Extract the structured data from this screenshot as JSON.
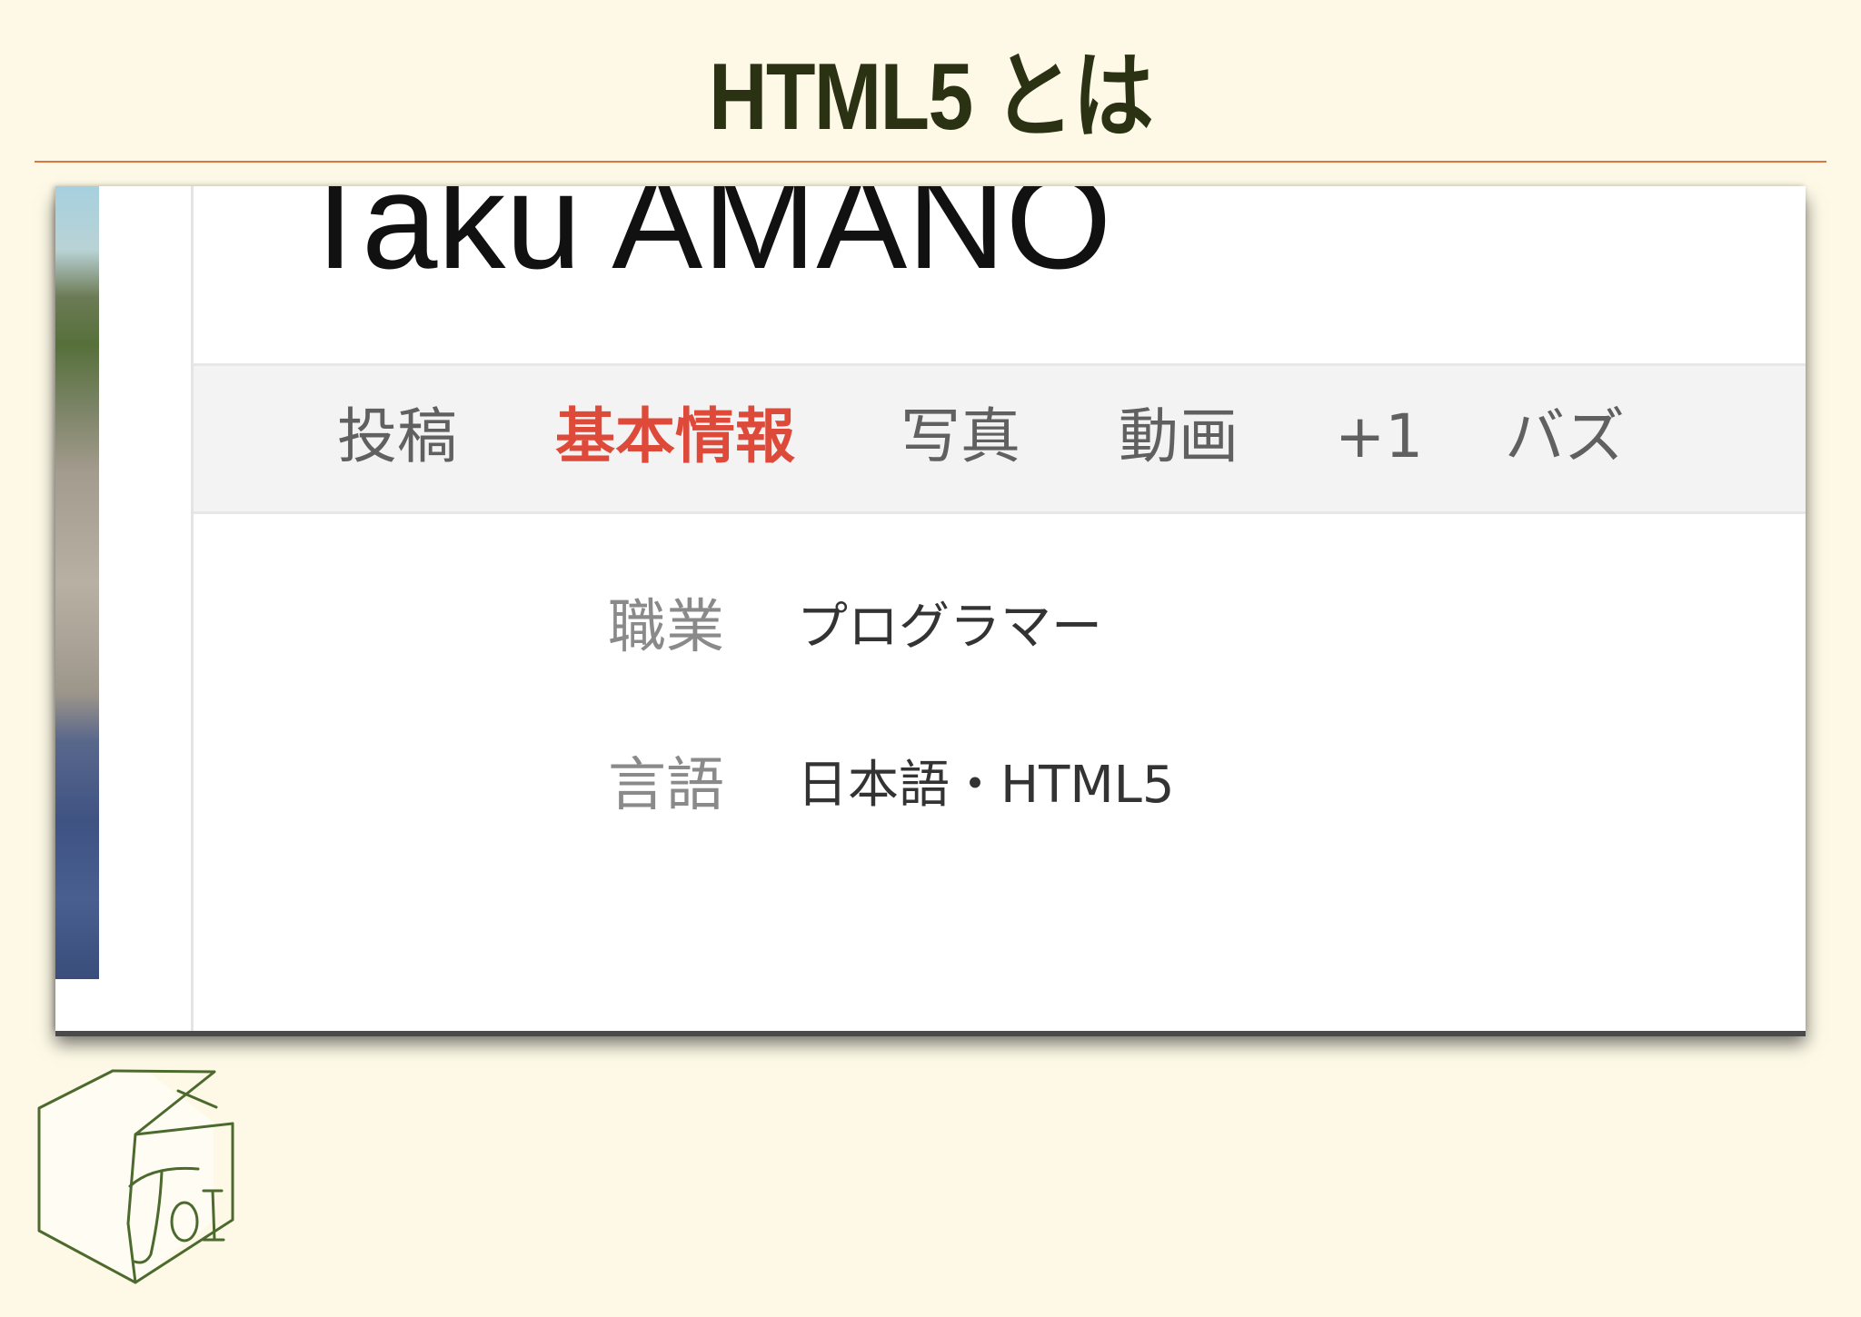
{
  "slide": {
    "title": "HTML5 とは"
  },
  "profile": {
    "name": "Taku AMANO",
    "tabs": [
      {
        "label": "投稿",
        "active": false
      },
      {
        "label": "基本情報",
        "active": true
      },
      {
        "label": "写真",
        "active": false
      },
      {
        "label": "動画",
        "active": false
      },
      {
        "label": "+1",
        "active": false
      },
      {
        "label": "バズ",
        "active": false
      }
    ],
    "info": [
      {
        "label": "職業",
        "value": "プログラマー"
      },
      {
        "label": "言語",
        "value": "日本語・HTML5"
      }
    ]
  },
  "logo": {
    "icon": "house-logo-icon",
    "text": "ToI"
  },
  "colors": {
    "background": "#fdf9e6",
    "title": "#2b3113",
    "title_rule": "#d9773f",
    "active_tab": "#de4a3a",
    "logo_stroke": "#4c6a2e"
  }
}
